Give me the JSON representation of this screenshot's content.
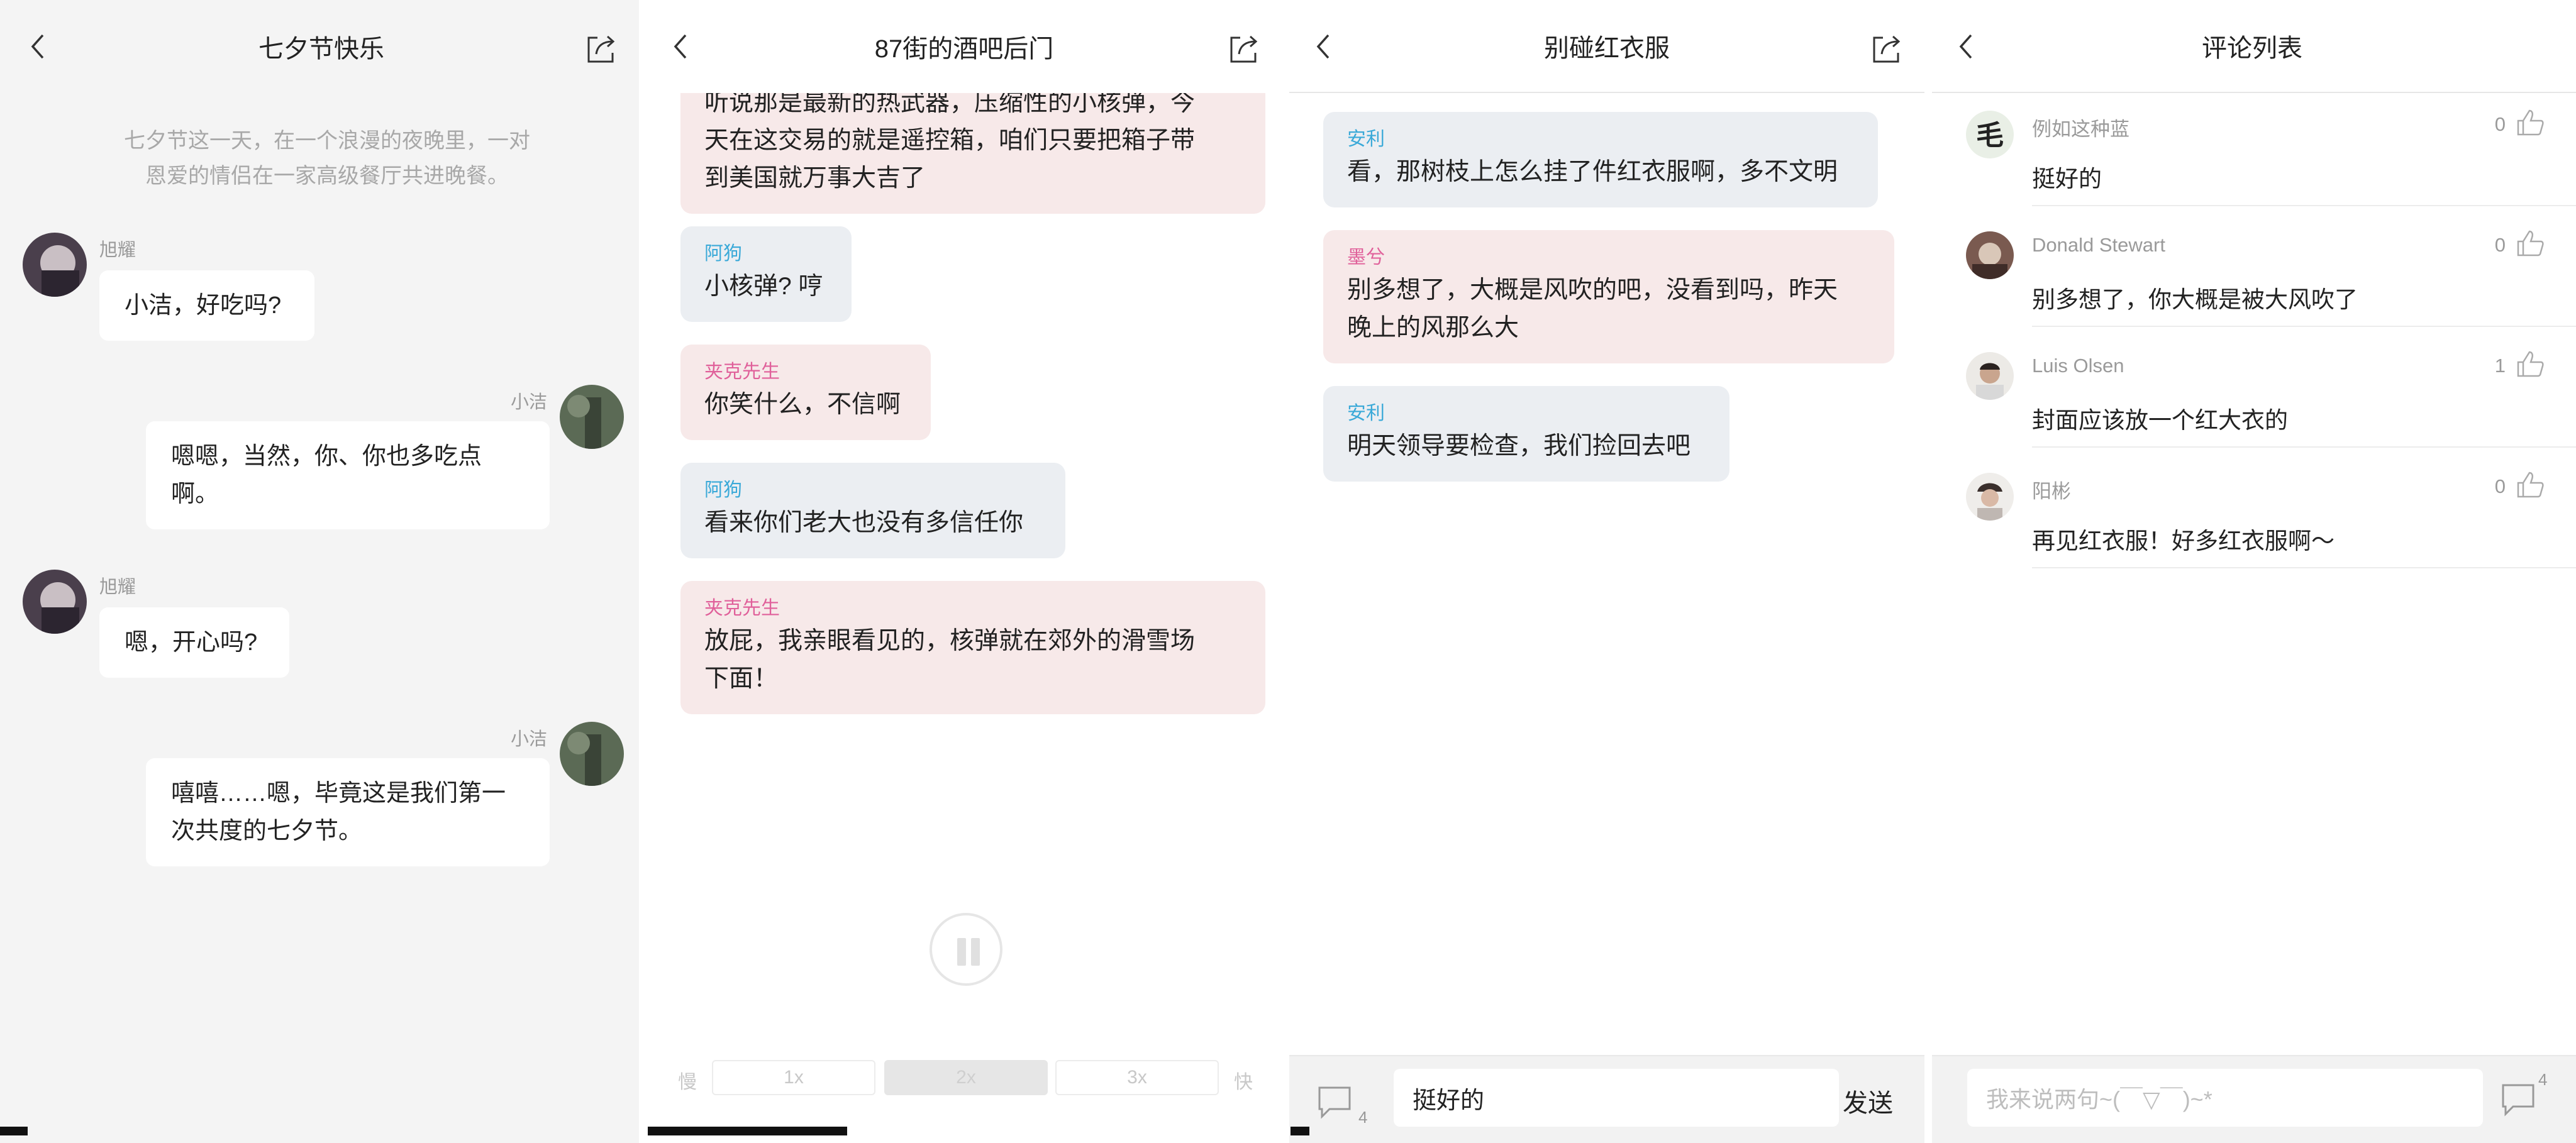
{
  "panel1": {
    "title": "七夕节快乐",
    "intro_line1": "七夕节这一天，在一个浪漫的夜晚里，一对",
    "intro_line2": "恩爱的情侣在一家高级餐厅共进晚餐。",
    "messages": [
      {
        "name": "旭耀",
        "line1": "小洁，好吃吗?",
        "line2": ""
      },
      {
        "name": "小洁",
        "line1": "嗯嗯，当然，你、你也多吃点",
        "line2": "啊。"
      },
      {
        "name": "旭耀",
        "line1": "嗯，开心吗?",
        "line2": ""
      },
      {
        "name": "小洁",
        "line1": "嘻嘻……嗯，毕竟这是我们第一",
        "line2": "次共度的七夕节。"
      }
    ]
  },
  "panel2": {
    "title": "87街的酒吧后门",
    "messages": [
      {
        "name": "",
        "line1": "听说那是最新的热武器，压缩性的小核弹，今",
        "line2": "天在这交易的就是遥控箱，咱们只要把箱子带",
        "line3": "到美国就万事大吉了"
      },
      {
        "name": "阿狗",
        "line1": "小核弹? 哼"
      },
      {
        "name": "夹克先生",
        "line1": "你笑什么，不信啊"
      },
      {
        "name": "阿狗",
        "line1": "看来你们老大也没有多信任你"
      },
      {
        "name": "夹克先生",
        "line1": "放屁，我亲眼看见的，核弹就在郊外的滑雪场",
        "line2": "下面！"
      }
    ],
    "speed": {
      "slow": "慢",
      "fast": "快",
      "options": [
        "1x",
        "2x",
        "3x"
      ],
      "selected": "2x"
    },
    "progress": 0.31
  },
  "panel3": {
    "title": "别碰红衣服",
    "messages": [
      {
        "name": "安利",
        "line1": "看，那树枝上怎么挂了件红衣服啊，多不文明"
      },
      {
        "name": "墨兮",
        "line1": "别多想了，大概是风吹的吧，没看到吗，昨天",
        "line2": "晚上的风那么大"
      },
      {
        "name": "安利",
        "line1": "明天领导要检查，我们捡回去吧"
      }
    ],
    "input_value": "挺好的",
    "send_label": "发送",
    "comment_count": "4",
    "progress": 0.015
  },
  "panel4": {
    "title": "评论列表",
    "comments": [
      {
        "user": "例如这种蓝",
        "text": "挺好的",
        "likes": "0"
      },
      {
        "user": "Donald Stewart",
        "text": "别多想了，你大概是被大风吹了",
        "likes": "0"
      },
      {
        "user": "Luis Olsen",
        "text": "封面应该放一个红大衣的",
        "likes": "1"
      },
      {
        "user": "阳彬",
        "text": "再见红衣服！好多红衣服啊～",
        "likes": "0"
      }
    ],
    "avatar_glyph": "毛",
    "input_placeholder": "我来说两句~(￣▽￣)~*",
    "comment_count": "4"
  },
  "colors": {
    "name_cyan": "#3aa9d8",
    "name_pink": "#e0609a",
    "bubble_blue": "#ebeef2",
    "bubble_pink": "#f7e9e9"
  }
}
